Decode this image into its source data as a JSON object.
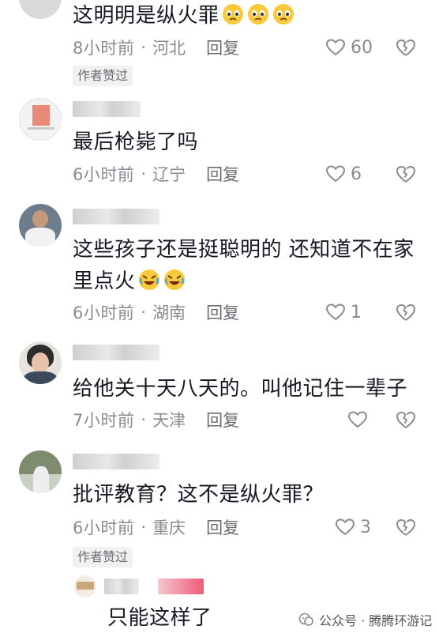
{
  "comments": [
    {
      "text": "这明明是纵火罪",
      "time": "8小时前",
      "location": "河北",
      "reply": "回复",
      "likes": "60",
      "badge": "作者赞过",
      "emoji": [
        "pleading-face",
        "pleading-face",
        "pleading-face"
      ]
    },
    {
      "text": "最后枪毙了吗",
      "time": "6小时前",
      "location": "辽宁",
      "reply": "回复",
      "likes": "6"
    },
    {
      "text": "这些孩子还是挺聪明的 还知道不在家里点火",
      "time": "6小时前",
      "location": "湖南",
      "reply": "回复",
      "likes": "1",
      "emoji": [
        "rolling-laughing",
        "rolling-laughing"
      ]
    },
    {
      "text": "给他关十天八天的。叫他记住一辈子",
      "time": "7小时前",
      "location": "天津",
      "reply": "回复",
      "likes": ""
    },
    {
      "text": "批评教育？这不是纵火罪？",
      "time": "6小时前",
      "location": "重庆",
      "reply": "回复",
      "likes": "3",
      "badge": "作者赞过"
    },
    {
      "text": "只能这样了"
    }
  ],
  "separator": "·",
  "watermark": "公众号 · 腾腾环游记",
  "colors": {
    "text": "#161823",
    "meta": "#8a8b91",
    "badge_bg": "#f1f1f2"
  }
}
